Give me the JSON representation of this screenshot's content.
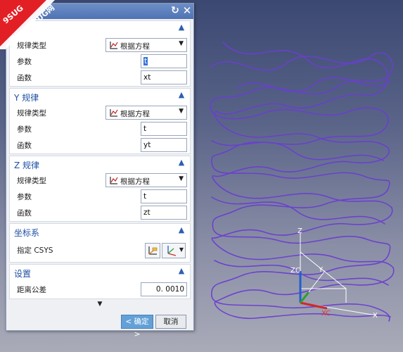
{
  "watermark": {
    "line1": "9SUG",
    "line2": "学UG就上UG网"
  },
  "dialog": {
    "title": "",
    "x_law": {
      "title": "",
      "law_type_label": "规律类型",
      "law_type_value": "根据方程",
      "param_label": "参数",
      "param_value": "t",
      "func_label": "函数",
      "func_value": "xt"
    },
    "y_law": {
      "title": "Y 规律",
      "law_type_label": "规律类型",
      "law_type_value": "根据方程",
      "param_label": "参数",
      "param_value": "t",
      "func_label": "函数",
      "func_value": "yt"
    },
    "z_law": {
      "title": "Z 规律",
      "law_type_label": "规律类型",
      "law_type_value": "根据方程",
      "param_label": "参数",
      "param_value": "t",
      "func_label": "函数",
      "func_value": "zt"
    },
    "csys": {
      "title": "坐标系",
      "specify_label": "指定 CSYS"
    },
    "settings": {
      "title": "设置",
      "tolerance_label": "距离公差",
      "tolerance_value": "0. 0010"
    },
    "ok_label": "< 确定 >",
    "cancel_label": "取消"
  },
  "viewport": {
    "axis_labels": {
      "z": "Z",
      "zc": "ZC",
      "y": "Y",
      "x": "X",
      "xc": "XC"
    },
    "colors": {
      "curve": "#6a3fd0",
      "zc_axis": "#1f5fd0",
      "xc_axis": "#d02828",
      "yc_axis": "#2aa02a"
    }
  }
}
